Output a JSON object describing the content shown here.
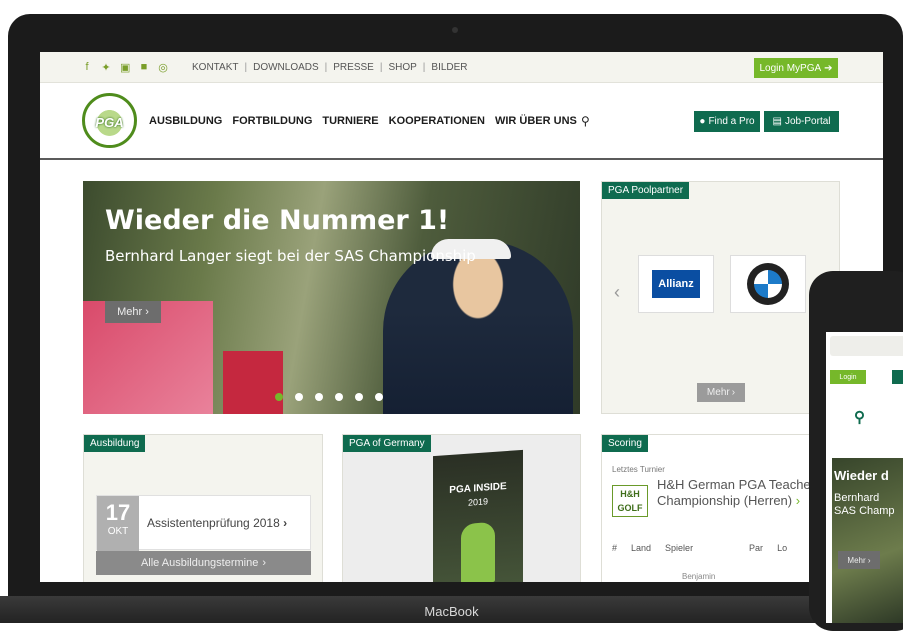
{
  "device": {
    "brand": "MacBook"
  },
  "topbar": {
    "social_icons": [
      "facebook-icon",
      "twitter-icon",
      "youtube-icon",
      "xing-icon",
      "instagram-icon"
    ],
    "links": [
      "KONTAKT",
      "DOWNLOADS",
      "PRESSE",
      "SHOP",
      "BILDER"
    ],
    "login_label": "Login MyPGA"
  },
  "nav": {
    "logo_text": "PGA",
    "items": [
      "AUSBILDUNG",
      "FORTBILDUNG",
      "TURNIERE",
      "KOOPERATIONEN",
      "WIR ÜBER UNS"
    ],
    "find_pro_label": "Find a Pro",
    "job_portal_label": "Job-Portal"
  },
  "hero": {
    "title": "Wieder die Nummer 1!",
    "subtitle": "Bernhard Langer siegt bei der SAS Championship",
    "more_label": "Mehr",
    "slide_count": 6,
    "active_slide": 1
  },
  "partner": {
    "tag": "PGA Poolpartner",
    "allianz_label": "Allianz",
    "more_label": "Mehr"
  },
  "ausbildung": {
    "tag": "Ausbildung",
    "date_day": "17",
    "date_month": "OKT",
    "event": "Assistentenprüfung 2018",
    "all_dates_label": "Alle Ausbildungstermine"
  },
  "pga_germany": {
    "tag": "PGA of Germany",
    "magazine_title": "PGA INSIDE",
    "magazine_year": "2019"
  },
  "scoring": {
    "tag": "Scoring",
    "last_tournament_label": "Letztes Turnier",
    "logo_text": "H&H GOLF",
    "tournament": "H&H German PGA Teachers Championship (Herren)",
    "columns": [
      "#",
      "Land",
      "Spieler",
      "Par",
      "Lo"
    ],
    "first_row_player": "Benjamin"
  },
  "phone": {
    "login_label": "Login",
    "hero_title": "Wieder d",
    "hero_sub_line1": "Bernhard",
    "hero_sub_line2": "SAS Champ",
    "more_label": "Mehr"
  }
}
